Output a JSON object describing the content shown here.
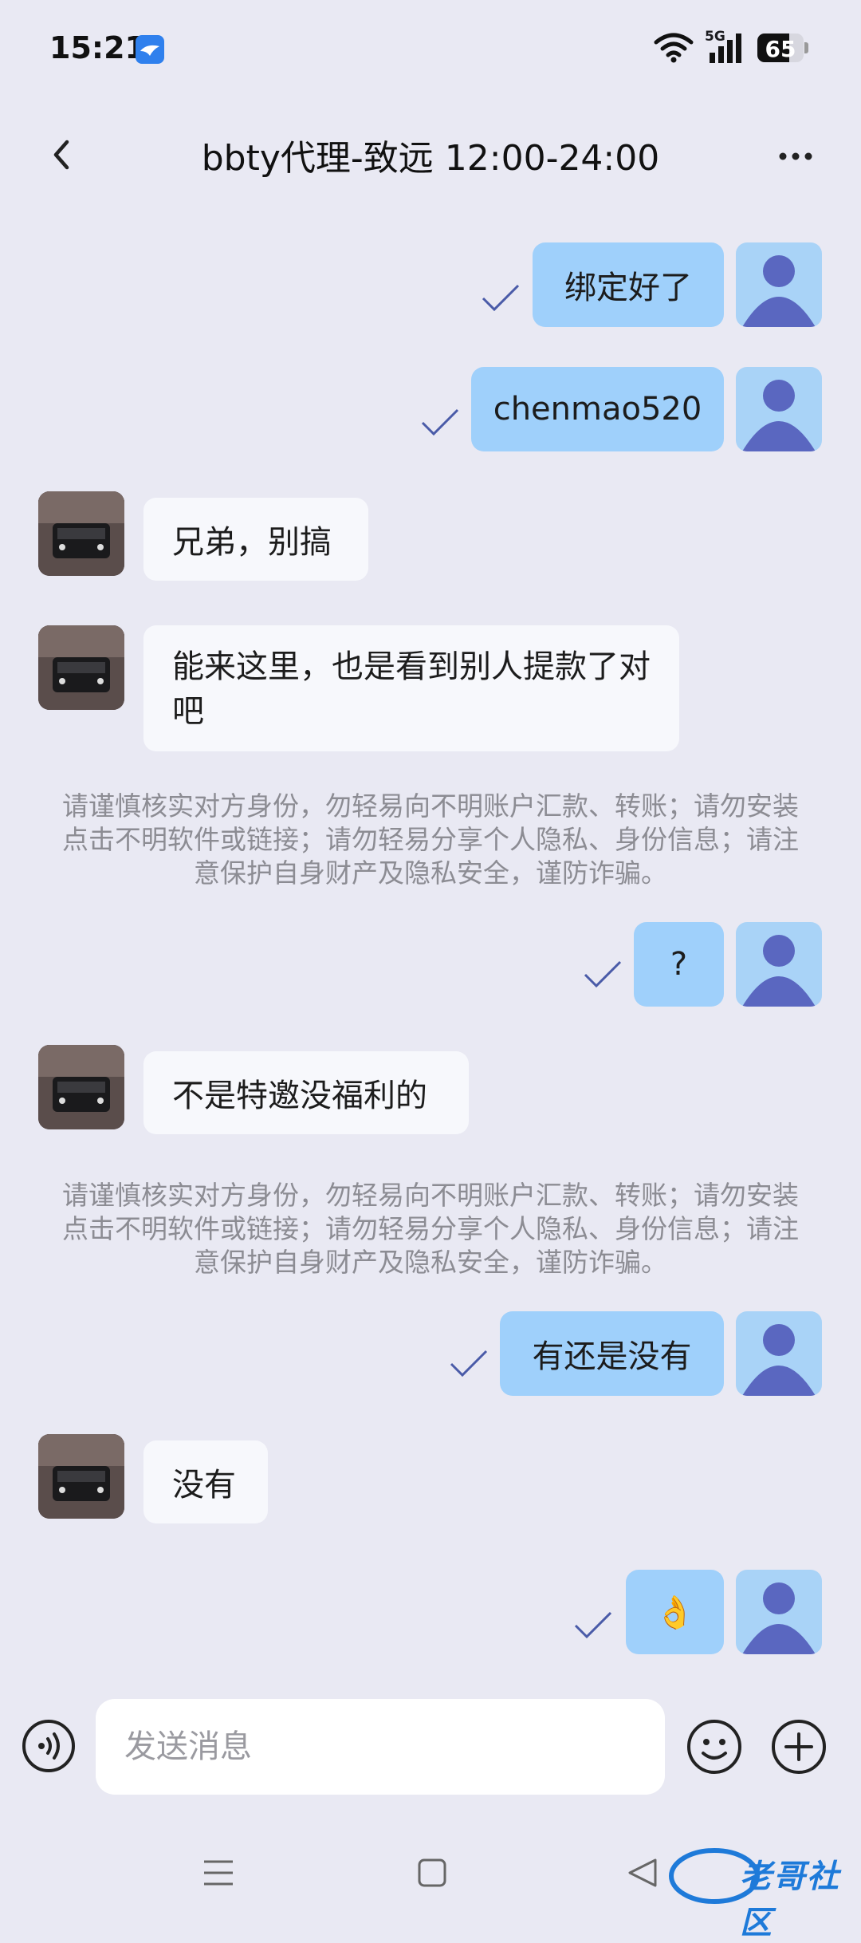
{
  "status_bar": {
    "time": "15:21",
    "network": "5G",
    "battery": "65"
  },
  "header": {
    "title": "bbty代理-致远 12:00-24:00"
  },
  "messages": [
    {
      "text": "绑定好了"
    },
    {
      "text": "chenmao520"
    },
    {
      "text": "兄弟，别搞"
    },
    {
      "text": "能来这里，也是看到别人提款了对吧"
    },
    {
      "text": "?"
    },
    {
      "text": "不是特邀没福利的"
    },
    {
      "text": "有还是没有"
    },
    {
      "text": "没有"
    },
    {
      "text": "👌"
    }
  ],
  "notices": [
    "请谨慎核实对方身份，勿轻易向不明账户汇款、转账；请勿安装点击不明软件或链接；请勿轻易分享个人隐私、身份信息；请注意保护自身财产及隐私安全，谨防诈骗。",
    "请谨慎核实对方身份，勿轻易向不明账户汇款、转账；请勿安装点击不明软件或链接；请勿轻易分享个人隐私、身份信息；请注意保护自身财产及隐私安全，谨防诈骗。"
  ],
  "input": {
    "placeholder": "发送消息"
  },
  "watermark": {
    "text": "老哥社区"
  },
  "colors": {
    "background": "#e9e9f3",
    "outgoing_bubble": "#9fd0fb",
    "incoming_bubble": "#f7f8fc",
    "tick": "#4a5ba8",
    "avatar_figure": "#5a67c0"
  }
}
